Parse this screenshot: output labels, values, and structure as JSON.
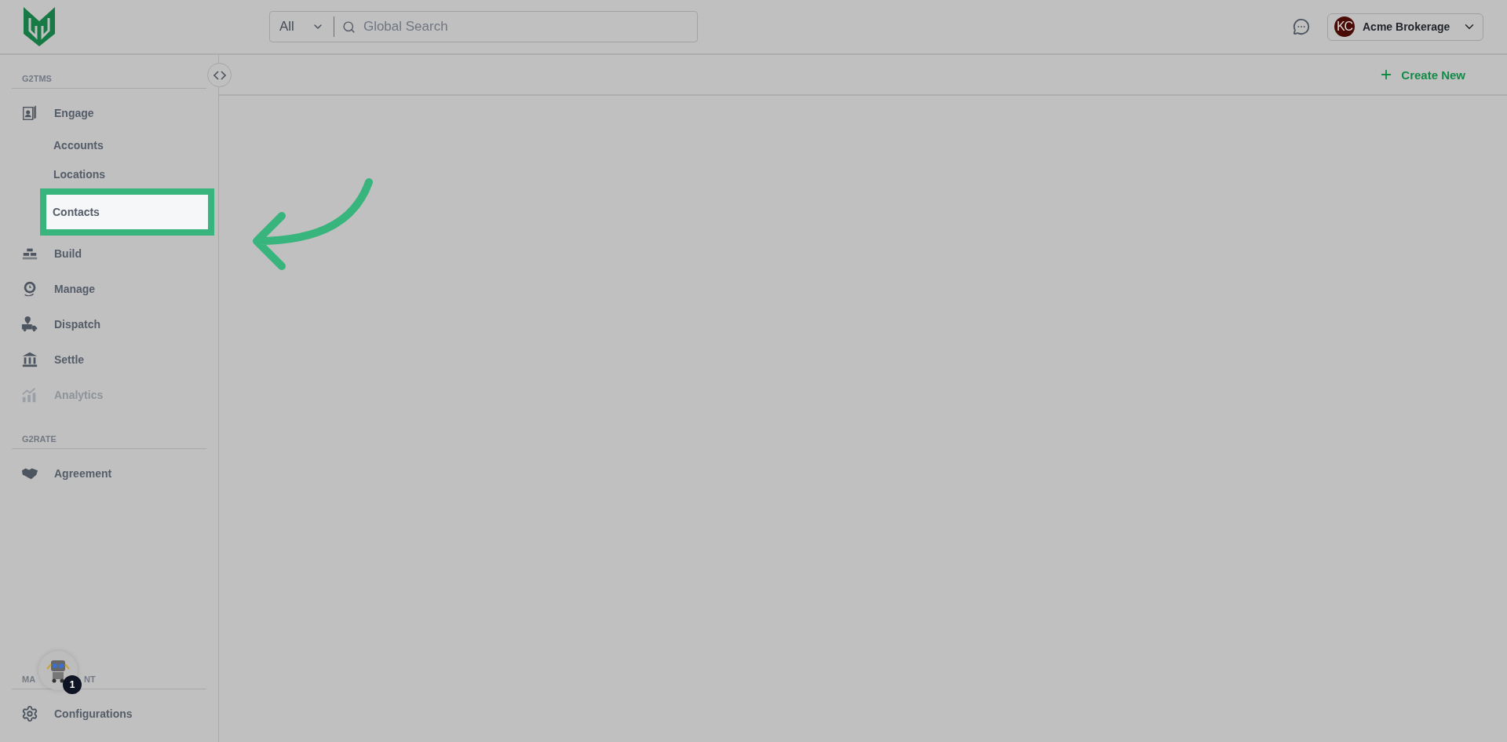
{
  "header": {
    "search": {
      "scope": "All",
      "placeholder": "Global Search"
    },
    "account": {
      "initials": "KC",
      "name": "Acme Brokerage"
    }
  },
  "toolbar": {
    "create_button": "Create New"
  },
  "sidebar": {
    "sections": [
      {
        "title": "G2TMS",
        "items": [
          {
            "label": "Engage",
            "disabled": false,
            "children": [
              {
                "label": "Accounts",
                "selected": false
              },
              {
                "label": "Locations",
                "selected": false
              },
              {
                "label": "Contacts",
                "selected": true
              }
            ]
          },
          {
            "label": "Build",
            "disabled": false
          },
          {
            "label": "Manage",
            "disabled": false
          },
          {
            "label": "Dispatch",
            "disabled": false
          },
          {
            "label": "Settle",
            "disabled": false
          },
          {
            "label": "Analytics",
            "disabled": true
          }
        ]
      },
      {
        "title": "G2RATE",
        "items": [
          {
            "label": "Agreement",
            "disabled": false
          }
        ]
      }
    ],
    "bottom_section": {
      "title_parts": [
        "MA",
        "NT"
      ],
      "items": [
        {
          "label": "Configurations",
          "disabled": false
        }
      ]
    }
  },
  "assistant": {
    "badge": "1"
  }
}
